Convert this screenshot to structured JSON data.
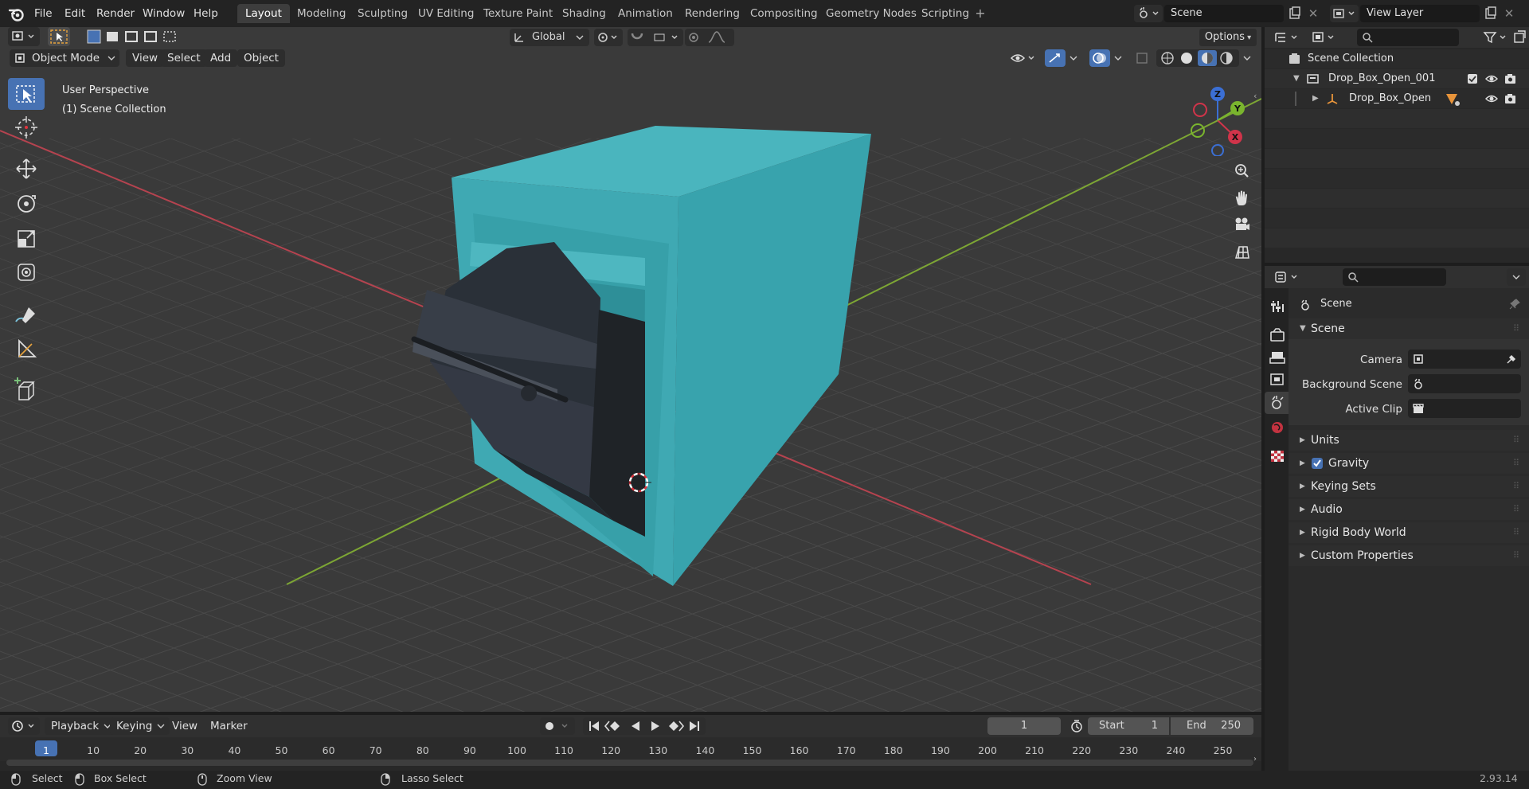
{
  "menu": [
    "File",
    "Edit",
    "Render",
    "Window",
    "Help"
  ],
  "workspaces": [
    "Layout",
    "Modeling",
    "Sculpting",
    "UV Editing",
    "Texture Paint",
    "Shading",
    "Animation",
    "Rendering",
    "Compositing",
    "Geometry Nodes",
    "Scripting"
  ],
  "active_workspace": "Layout",
  "scene_field": "Scene",
  "view_layer_field": "View Layer",
  "viewport": {
    "transform_orientation": "Global",
    "options_label": "Options",
    "mode": "Object Mode",
    "header_menu": [
      "View",
      "Select",
      "Add",
      "Object"
    ],
    "overlay_line1": "User Perspective",
    "overlay_line2": "(1) Scene Collection",
    "gizmo_axes": {
      "x": "X",
      "y": "Y",
      "z": "Z"
    }
  },
  "outliner": {
    "root": "Scene Collection",
    "collection": "Drop_Box_Open_001",
    "object": "Drop_Box_Open"
  },
  "properties": {
    "context_name": "Scene",
    "section": "Scene",
    "camera_label": "Camera",
    "background_label": "Background Scene",
    "clip_label": "Active Clip",
    "panels": [
      "Units",
      "Gravity",
      "Keying Sets",
      "Audio",
      "Rigid Body World",
      "Custom Properties"
    ],
    "gravity_checked": true
  },
  "timeline": {
    "menu": [
      "Playback",
      "Keying",
      "View",
      "Marker"
    ],
    "current_frame": "1",
    "start_label": "Start",
    "start_value": "1",
    "end_label": "End",
    "end_value": "250",
    "ruler": [
      "1",
      "10",
      "20",
      "30",
      "40",
      "50",
      "60",
      "70",
      "80",
      "90",
      "100",
      "110",
      "120",
      "130",
      "140",
      "150",
      "160",
      "170",
      "180",
      "190",
      "200",
      "210",
      "220",
      "230",
      "240",
      "250"
    ]
  },
  "statusbar": {
    "select": "Select",
    "box_select": "Box Select",
    "zoom_view": "Zoom View",
    "lasso_select": "Lasso Select",
    "version": "2.93.14"
  },
  "colors": {
    "accent": "#4772b3",
    "teal_box": "#38a3ad",
    "x_axis": "#b5434f",
    "y_axis": "#7da634",
    "viewport_bg": "#3b3b3b"
  }
}
